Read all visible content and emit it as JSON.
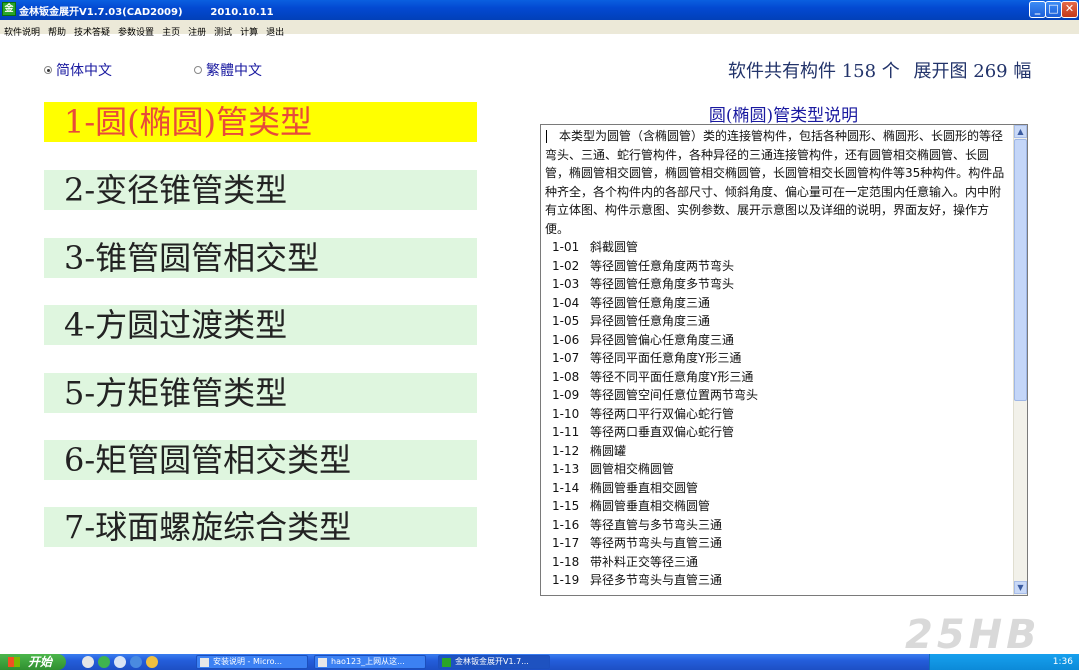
{
  "window": {
    "app_icon": "金",
    "title": "金林钣金展开V1.7.03(CAD2009)        2010.10.11",
    "min_symbol": "_",
    "max_symbol": "□",
    "close_symbol": "✕"
  },
  "menu": [
    "软件说明",
    "帮助",
    "技术答疑",
    "参数设置",
    "主页",
    "注册",
    "测试",
    "计算",
    "退出"
  ],
  "language": {
    "simplified": "简体中文",
    "traditional": "繁體中文",
    "selected": "simplified"
  },
  "stats": {
    "components": "软件共有构件 158 个",
    "drawings": "展开图 269 幅"
  },
  "categories": [
    "1-圆(椭圆)管类型",
    "2-变径锥管类型",
    "3-锥管圆管相交型",
    "4-方圆过渡类型",
    "5-方矩锥管类型",
    "6-矩管圆管相交类型",
    "7-球面螺旋综合类型"
  ],
  "description": {
    "title": "圆(椭圆)管类型说明",
    "paragraph": "本类型为圆管（含椭圆管）类的连接管构件，包括各种圆形、椭圆形、长圆形的等径弯头、三通、蛇行管构件，各种异径的三通连接管构件，还有圆管相交椭圆管、长圆管，椭圆管相交圆管，椭圆管相交椭圆管，长圆管相交长圆管构件等35种构件。构件品种齐全，各个构件内的各部尺寸、倾斜角度、偏心量可在一定范围内任意输入。内中附有立体图、构件示意图、实例参数、展开示意图以及详细的说明，界面友好，操作方便。",
    "items": [
      {
        "code": "1-01",
        "name": "斜截圆管"
      },
      {
        "code": "1-02",
        "name": "等径圆管任意角度两节弯头"
      },
      {
        "code": "1-03",
        "name": "等径圆管任意角度多节弯头"
      },
      {
        "code": "1-04",
        "name": "等径圆管任意角度三通"
      },
      {
        "code": "1-05",
        "name": "异径圆管任意角度三通"
      },
      {
        "code": "1-06",
        "name": "异径圆管偏心任意角度三通"
      },
      {
        "code": "1-07",
        "name": "等径同平面任意角度Y形三通"
      },
      {
        "code": "1-08",
        "name": "等径不同平面任意角度Y形三通"
      },
      {
        "code": "1-09",
        "name": "等径圆管空间任意位置两节弯头"
      },
      {
        "code": "1-10",
        "name": "等径两口平行双偏心蛇行管"
      },
      {
        "code": "1-11",
        "name": "等径两口垂直双偏心蛇行管"
      },
      {
        "code": "1-12",
        "name": "椭圆罐"
      },
      {
        "code": "1-13",
        "name": "圆管相交椭圆管"
      },
      {
        "code": "1-14",
        "name": "椭圆管垂直相交圆管"
      },
      {
        "code": "1-15",
        "name": "椭圆管垂直相交椭圆管"
      },
      {
        "code": "1-16",
        "name": "等径直管与多节弯头三通"
      },
      {
        "code": "1-17",
        "name": "等径两节弯头与直管三通"
      },
      {
        "code": "1-18",
        "name": "带补料正交等径三通"
      },
      {
        "code": "1-19",
        "name": "异径多节弯头与直管三通"
      }
    ]
  },
  "scrollbar": {
    "up_symbol": "▲",
    "down_symbol": "▼"
  },
  "watermark": "25HB",
  "taskbar": {
    "start_label": "开始",
    "tasks": [
      "安装说明 - Micro...",
      "hao123_上网从这...",
      "金林钣金展开V1.7..."
    ],
    "clock": "1:36"
  }
}
